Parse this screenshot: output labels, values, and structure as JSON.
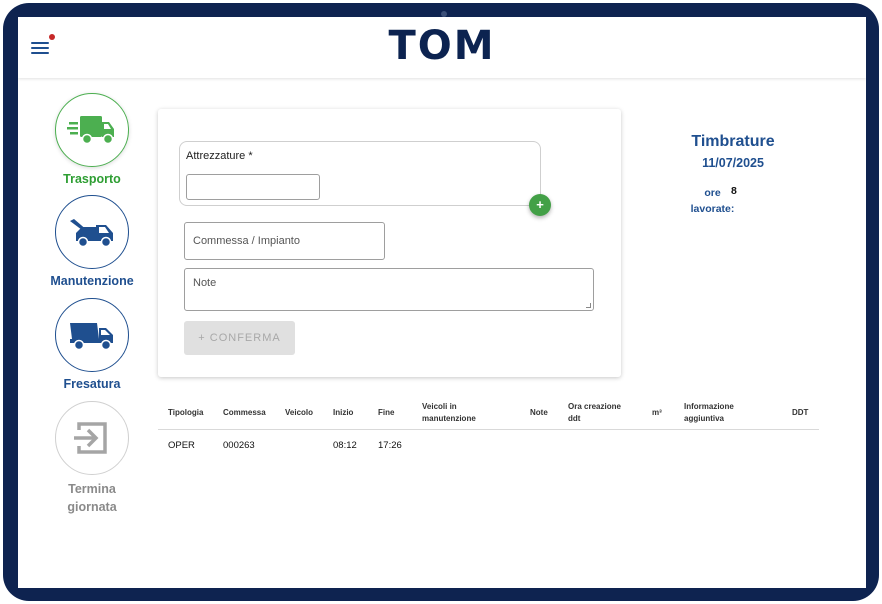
{
  "header": {
    "logo": "TOM",
    "menu_icon": "hamburger-menu-icon"
  },
  "sidebar": {
    "items": [
      {
        "label": "Trasporto",
        "icon": "truck-fast-icon",
        "color": "#2e9e33",
        "active": true
      },
      {
        "label": "Manutenzione",
        "icon": "tow-truck-icon",
        "color": "#1f4f8f"
      },
      {
        "label": "Fresatura",
        "icon": "dump-truck-icon",
        "color": "#1f4f8f"
      },
      {
        "label_line1": "Termina",
        "label_line2": "giornata",
        "icon": "logout-icon",
        "color": "#8a8a8a"
      }
    ]
  },
  "form": {
    "attrezzature_label": "Attrezzature *",
    "add_label": "+",
    "commessa_placeholder": "Commessa / Impianto",
    "note_placeholder": "Note",
    "confirm_label": "+ CONFERMA"
  },
  "timbrature": {
    "title": "Timbrature",
    "date": "11/07/2025",
    "ore_label_line1": "ore",
    "ore_label_line2": "lavorate:",
    "ore_value": "8"
  },
  "table": {
    "headers": {
      "tipologia": "Tipologia",
      "commessa": "Commessa",
      "veicolo": "Veicolo",
      "inizio": "Inizio",
      "fine": "Fine",
      "veicoli_line1": "Veicoli in",
      "veicoli_line2": "manutenzione",
      "note": "Note",
      "ora_line1": "Ora creazione",
      "ora_line2": "ddt",
      "m3": "m³",
      "info_line1": "Informazione",
      "info_line2": "aggiuntiva",
      "ddt": "DDT"
    },
    "rows": [
      {
        "tipologia": "OPER",
        "commessa": "000263",
        "veicolo": "",
        "inizio": "08:12",
        "fine": "17:26"
      }
    ]
  },
  "colors": {
    "brand_navy": "#0c2350",
    "accent_blue": "#1f4f8f",
    "accent_green": "#2e9e33",
    "add_button_green": "#43a047"
  }
}
